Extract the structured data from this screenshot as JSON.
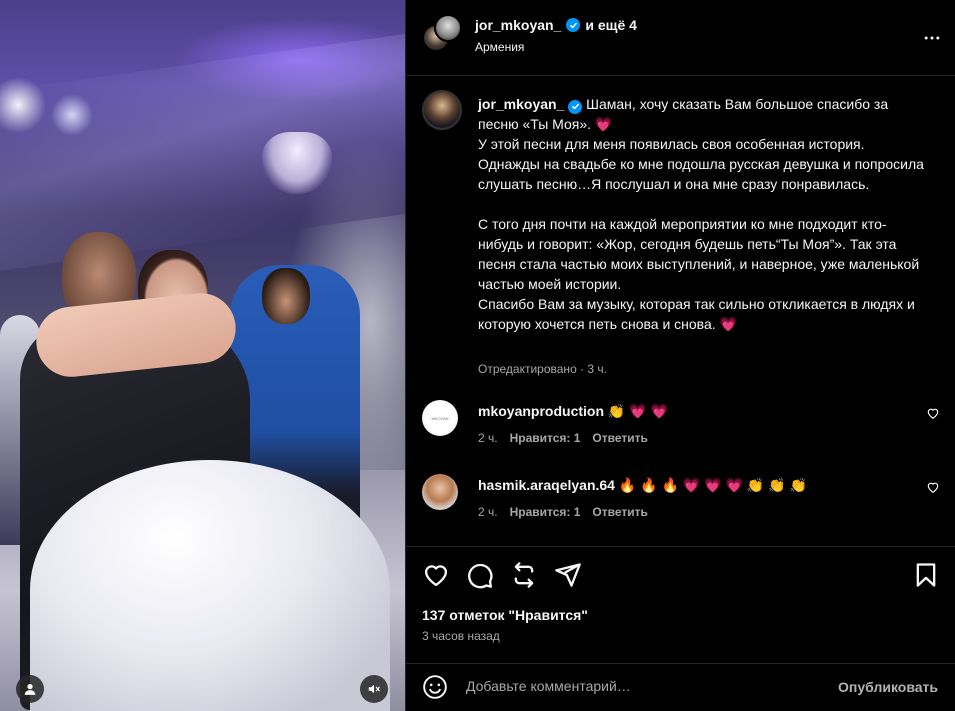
{
  "header": {
    "username": "jor_mkoyan_",
    "collab_text": "и ещё 4",
    "location": "Армения",
    "more_icon": "more-horizontal-icon"
  },
  "caption": {
    "username": "jor_mkoyan_",
    "text": "Шаман, хочу сказать Вам большое спасибо за песню «Ты Моя». 💗\nУ этой песни для меня появилась своя особенная история. Однажды на свадьбе ко мне подошла русская девушка и попросила слушать песню…Я послушал и она мне сразу понравилась.\n\nС того дня почти на каждой мероприятии ко мне подходит кто-нибудь и говорит: «Жор, сегодня будешь петь“Ты Моя”». Так эта песня стала частью моих выступлений, и наверное, уже маленькой частью моей истории.\nСпасибо Вам за музыку, которая так сильно откликается в людях и которую хочется петь снова и снова. 💗",
    "meta": "Отредактировано · 3 ч."
  },
  "comments": [
    {
      "username": "mkoyanproduction",
      "text": "👏 💗 💗",
      "time": "2 ч.",
      "likes": "Нравится: 1",
      "reply": "Ответить"
    },
    {
      "username": "hasmik.araqelyan.64",
      "text": "🔥 🔥 🔥 💗 💗 💗 👏 👏 👏",
      "time": "2 ч.",
      "likes": "Нравится: 1",
      "reply": "Ответить"
    }
  ],
  "actions": {
    "likes_text": "137 отметок \"Нравится\"",
    "time_ago": "3 часов назад"
  },
  "composer": {
    "placeholder": "Добавьте комментарий…",
    "publish_label": "Опубликовать"
  },
  "colors": {
    "background": "#000000",
    "verified": "#0095f6",
    "secondary_text": "#a8a8a8",
    "divider": "#262626"
  }
}
